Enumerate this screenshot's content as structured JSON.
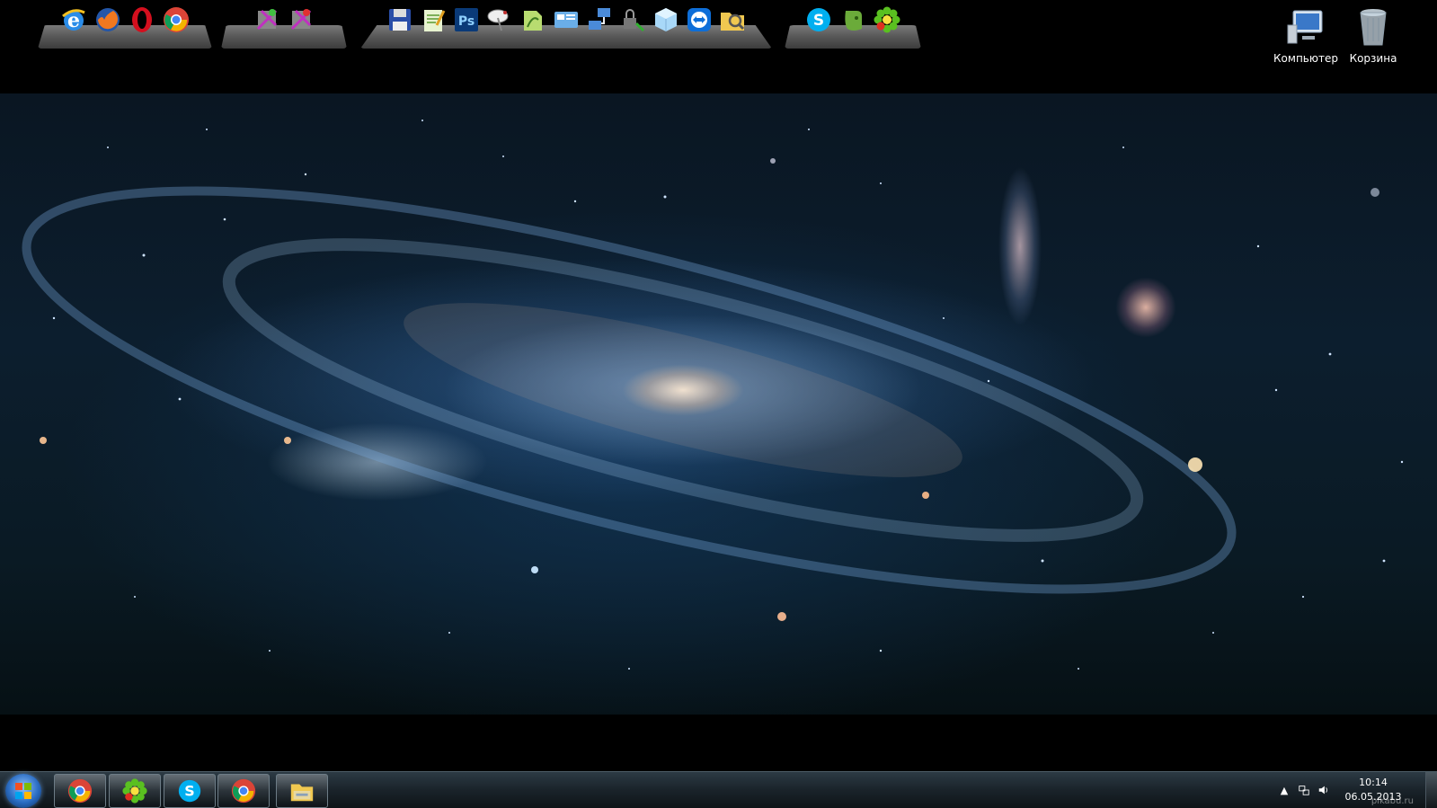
{
  "desktop": {
    "icons": [
      {
        "label": "Компьютер",
        "icon": "computer-icon"
      },
      {
        "label": "Корзина",
        "icon": "recycle-bin-icon"
      }
    ]
  },
  "docks": [
    {
      "name": "browsers",
      "icons": [
        "internet-explorer-icon",
        "firefox-icon",
        "opera-icon",
        "chrome-icon"
      ]
    },
    {
      "name": "tools",
      "icons": [
        "slik-tool-icon",
        "slik-tool-2-icon"
      ]
    },
    {
      "name": "utilities",
      "icons": [
        "floppy-save-icon",
        "notepad-icon",
        "photoshop-icon",
        "satellite-dish-icon",
        "edit-icon",
        "control-panel-icon",
        "network-icon",
        "lock-network-icon",
        "cube-icon",
        "teamviewer-icon",
        "search-folder-icon"
      ]
    },
    {
      "name": "messengers",
      "icons": [
        "skype-icon",
        "evernote-icon",
        "icq-icon"
      ]
    }
  ],
  "photoshop_label": "Ps",
  "skype_letter": "S",
  "taskbar": {
    "start": "start-icon",
    "buttons": [
      "chrome-icon",
      "icq-icon",
      "skype-icon",
      "chrome-icon",
      "explorer-folder-icon"
    ],
    "tray": [
      "show-hidden-icons-arrow",
      "network-tray-icon",
      "volume-tray-icon"
    ],
    "clock": {
      "time": "10:14",
      "date": "06.05.2013"
    }
  },
  "watermark": "pikabu.ru",
  "colors": {
    "taskbar": "#1a232a",
    "desktop": "#000000",
    "label": "#ffffff"
  }
}
